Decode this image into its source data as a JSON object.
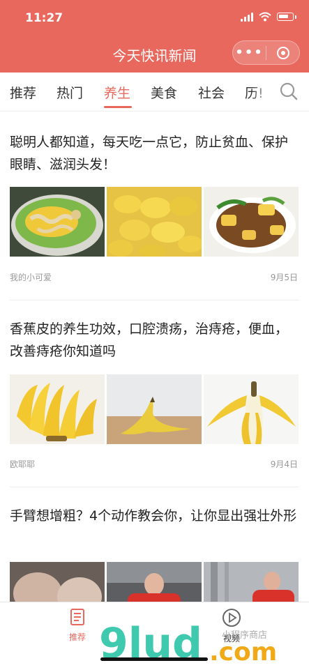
{
  "status_bar": {
    "time": "11:27"
  },
  "header": {
    "title": "今天快讯新闻",
    "more_icon": "more-dots-icon",
    "close_icon": "target-icon"
  },
  "tabs": [
    {
      "label": "推荐",
      "active": false
    },
    {
      "label": "热门",
      "active": false
    },
    {
      "label": "养生",
      "active": true
    },
    {
      "label": "美食",
      "active": false
    },
    {
      "label": "社会",
      "active": false
    },
    {
      "label": "历!",
      "active": false
    }
  ],
  "articles": [
    {
      "title": "聪明人都知道，每天吃一点它，防止贫血、保护眼睛、滋润头发！",
      "author": "我的小可爱",
      "date": "9月5日"
    },
    {
      "title": "香蕉皮的养生功效，口腔溃疡，治痔疮，便血，改善痔疮你知道吗",
      "author": "欧耶耶",
      "date": "9月4日"
    },
    {
      "title": "手臂想增粗？4个动作教会你，让你显出强壮外形",
      "author": "",
      "date": ""
    }
  ],
  "bottom_nav": [
    {
      "label": "推荐",
      "icon": "document-icon",
      "active": true
    },
    {
      "label": "视频",
      "icon": "play-circle-icon",
      "active": false
    }
  ],
  "watermark": {
    "logo": "9lud.com",
    "caption": "小程序商店"
  },
  "colors": {
    "accent": "#E8685E",
    "text": "#222222",
    "meta": "#999999"
  }
}
